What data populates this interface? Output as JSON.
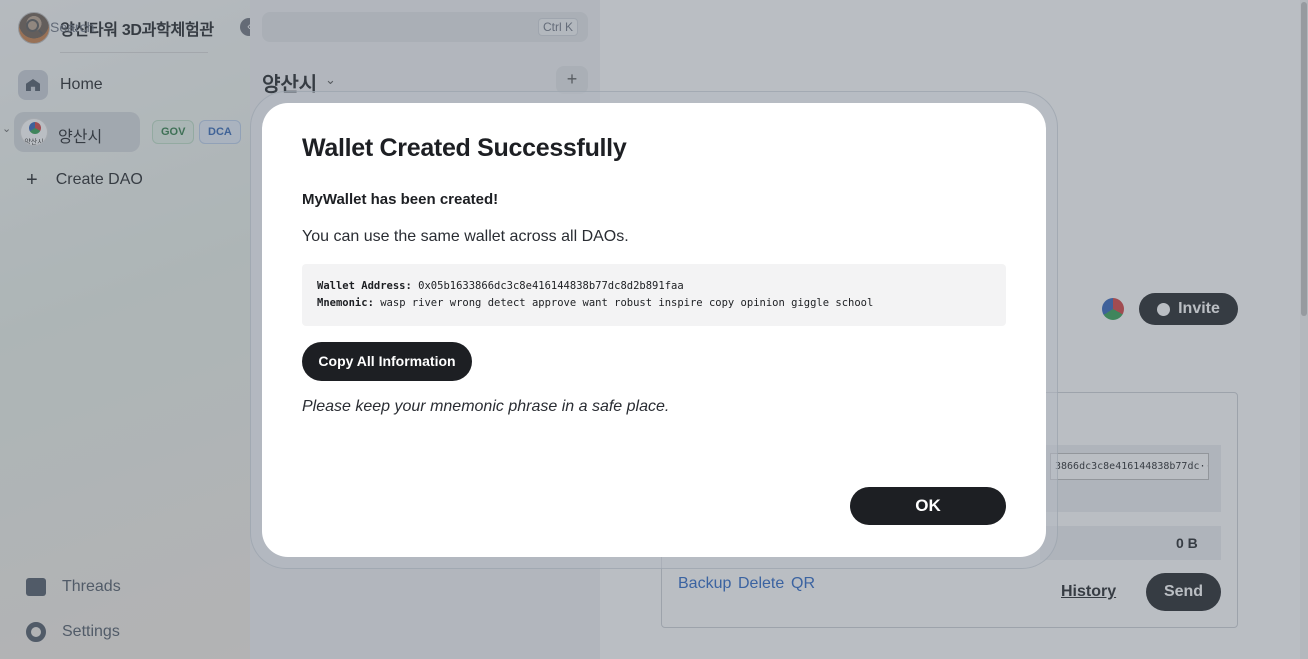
{
  "workspace": {
    "name": "양산타워 3D과학체험관"
  },
  "sidebar": {
    "home_label": "Home",
    "dao": {
      "name": "양산시",
      "logo_text": "양산시",
      "badges": [
        "GOV",
        "DCA"
      ]
    },
    "create_label": "Create DAO",
    "threads_label": "Threads",
    "settings_label": "Settings"
  },
  "search": {
    "placeholder": "Search",
    "shortcut": "Ctrl K"
  },
  "channel": {
    "title": "양산시",
    "add_label": "+"
  },
  "wallet_panel": {
    "address_preview": "3866dc3c8e416144838b77dc···",
    "balance": "0 B",
    "links": [
      "Backup",
      "Delete",
      "QR"
    ],
    "history_label": "History",
    "send_label": "Send",
    "invite_label": "Invite"
  },
  "modal": {
    "title": "Wallet Created Successfully",
    "subtitle": "MyWallet has been created!",
    "message": "You can use the same wallet across all DAOs.",
    "address_label": "Wallet Address:",
    "address_value": "0x05b1633866dc3c8e416144838b77dc8d2b891faa",
    "mnemonic_label": "Mnemonic:",
    "mnemonic_value": "wasp river wrong detect approve want robust inspire copy opinion giggle school",
    "copy_button": "Copy All Information",
    "note": "Please keep your mnemonic phrase in a safe place.",
    "ok_button": "OK"
  },
  "colors": {
    "primary_dark": "#1d1f23",
    "link_blue": "#2563c4",
    "gov_badge": "#2b7a44",
    "dca_badge": "#2d62b4"
  }
}
